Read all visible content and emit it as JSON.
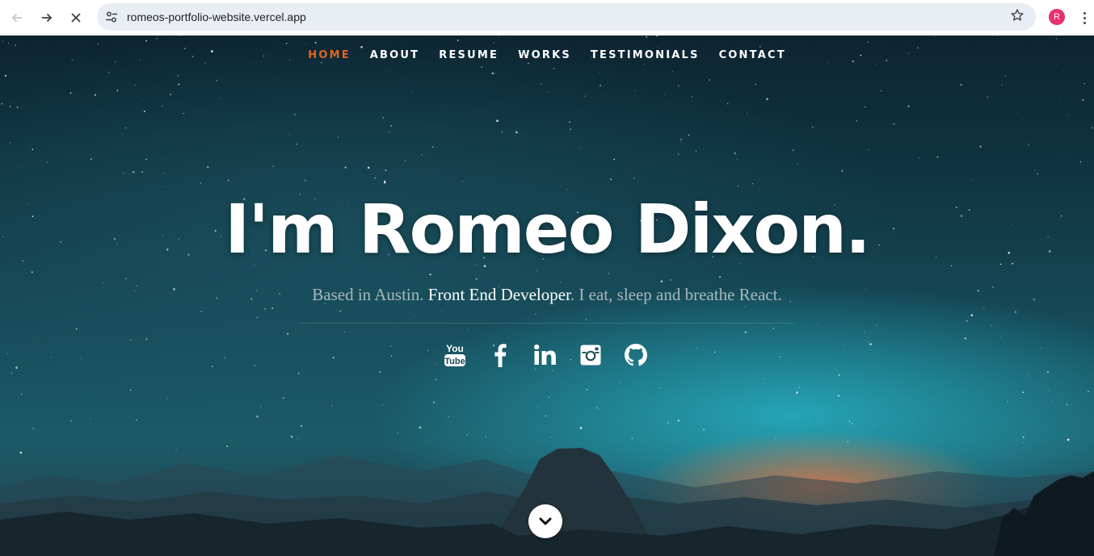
{
  "browser": {
    "url": "romeos-portfolio-website.vercel.app",
    "profile_initial": "R",
    "icons": {
      "back": "arrow-left-icon",
      "forward": "arrow-right-icon",
      "stop": "close-icon",
      "site_info": "tune-icon",
      "bookmark": "star-outline-icon",
      "menu": "kebab-menu-icon"
    }
  },
  "nav": {
    "items": [
      {
        "label": "HOME",
        "active": true
      },
      {
        "label": "ABOUT",
        "active": false
      },
      {
        "label": "RESUME",
        "active": false
      },
      {
        "label": "WORKS",
        "active": false
      },
      {
        "label": "TESTIMONIALS",
        "active": false
      },
      {
        "label": "CONTACT",
        "active": false
      }
    ],
    "active_color": "#e2651f"
  },
  "hero": {
    "headline": "I'm Romeo Dixon.",
    "tagline_prefix": "Based in Austin. ",
    "tagline_strong": "Front End Developer",
    "tagline_suffix": ". I eat, sleep and breathe React."
  },
  "social": [
    {
      "name": "youtube-icon"
    },
    {
      "name": "facebook-icon"
    },
    {
      "name": "linkedin-icon"
    },
    {
      "name": "instagram-icon"
    },
    {
      "name": "github-icon"
    }
  ],
  "scroll_down": {
    "icon": "chevron-down-icon"
  }
}
